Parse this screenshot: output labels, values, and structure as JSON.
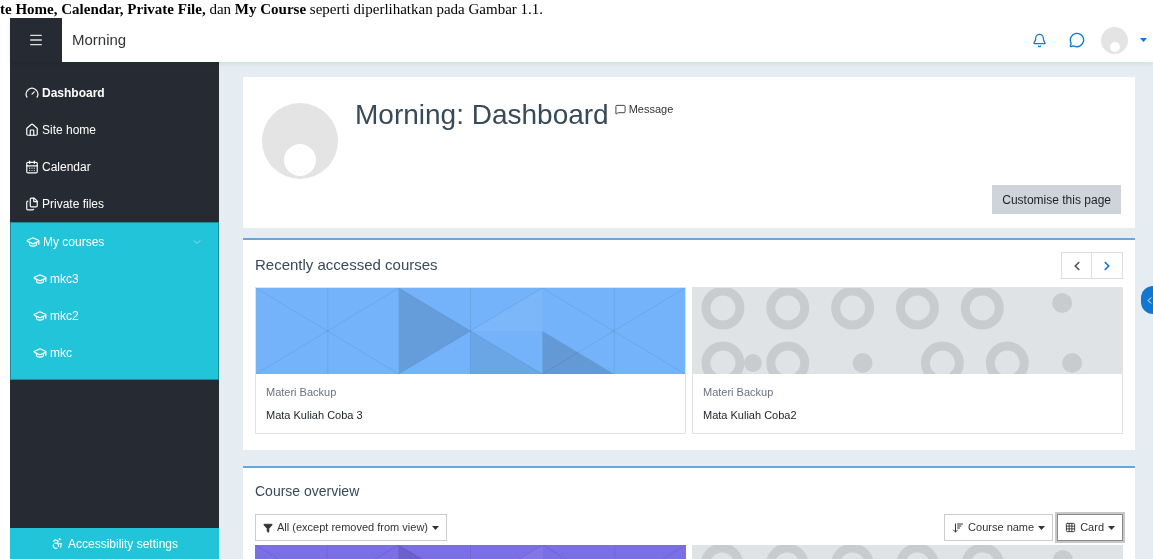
{
  "caption": "**te Home, Calendar, Private File,** dan **My Course** seperti diperlihatkan pada Gambar 1.1.",
  "navbar": {
    "site_name": "Morning"
  },
  "sidebar": {
    "items": [
      {
        "label": "Dashboard",
        "selected": true,
        "expanded": false
      },
      {
        "label": "Site home",
        "selected": false,
        "expanded": false
      },
      {
        "label": "Calendar",
        "selected": false,
        "expanded": false
      },
      {
        "label": "Private files",
        "selected": false,
        "expanded": false
      },
      {
        "label": "My courses",
        "selected": false,
        "expanded": true,
        "children": [
          {
            "label": "mkc3",
            "selected": false
          },
          {
            "label": "mkc2",
            "selected": false
          },
          {
            "label": "mkc",
            "selected": false
          }
        ]
      }
    ],
    "footer": "Accessibility settings"
  },
  "header": {
    "title": "Morning: Dashboard",
    "message_link": "Message",
    "button": "Customise this page"
  },
  "recent": {
    "title": "Recently accessed courses",
    "courses": [
      {
        "category": "Materi Backup",
        "name": "Mata Kuliah Coba 3",
        "kind": "triangles",
        "color": "#74b3f9"
      },
      {
        "category": "Materi Backup",
        "name": "Mata Kuliah Coba2",
        "kind": "circles",
        "color": "#dfe3e6"
      }
    ]
  },
  "overview": {
    "title": "Course overview",
    "filter": "All (except removed from view)",
    "sort": "Course name",
    "view": {
      "label": "Card",
      "focused": true
    },
    "courses": [
      {
        "kind": "triangles",
        "color": "#7b6fe6"
      },
      {
        "kind": "circles",
        "color": "#dfe3e6"
      }
    ]
  }
}
